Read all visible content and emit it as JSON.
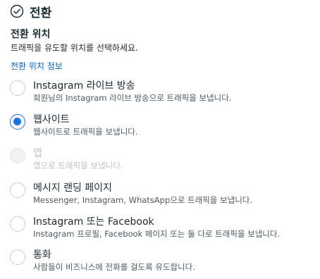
{
  "header": {
    "title": "전환",
    "icon": "check-circle-icon"
  },
  "destination": {
    "title": "전환 위치",
    "description": "트래픽을 유도할 위치를 선택하세요.",
    "info_link": "전환 위치 정보"
  },
  "options": [
    {
      "label": "Instagram 라이브 방송",
      "description": "회원님의 Instagram 라이브 방송으로 트래픽을 보냅니다.",
      "selected": false,
      "disabled": false
    },
    {
      "label": "웹사이트",
      "description": "웹사이트로 트래픽을 보냅니다.",
      "selected": true,
      "disabled": false
    },
    {
      "label": "앱",
      "description": "앱으로 트래픽을 보냅니다.",
      "selected": false,
      "disabled": true
    },
    {
      "label": "메시지 랜딩 페이지",
      "description": "Messenger, Instagram, WhatsApp으로 트래픽을 보냅니다.",
      "selected": false,
      "disabled": false
    },
    {
      "label": "Instagram 또는 Facebook",
      "description": "Instagram 프로필, Facebook 페이지 또는 둘 다로 트래픽을 보냅니다.",
      "selected": false,
      "disabled": false
    },
    {
      "label": "통화",
      "description": "사람들이 비즈니스에 전화를 걸도록 유도합니다.",
      "selected": false,
      "disabled": false
    }
  ],
  "colors": {
    "accent": "#1b74e4",
    "link": "#0064d1",
    "text": "#1c2b33",
    "secondary_text": "#4b5a66",
    "disabled_text": "#bcc0c4",
    "check": "#1c2b33"
  }
}
